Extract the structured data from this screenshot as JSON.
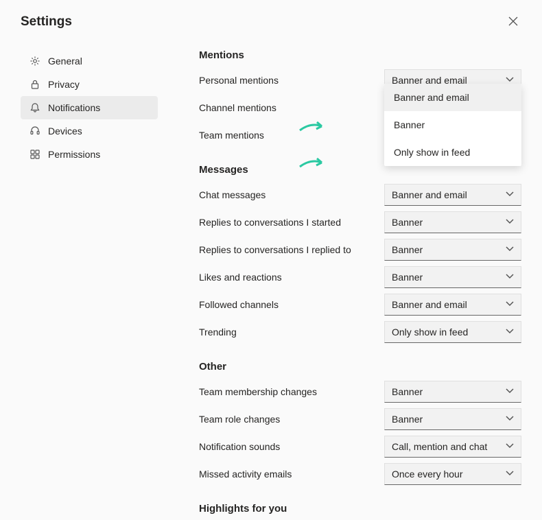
{
  "header": {
    "title": "Settings"
  },
  "sidebar": {
    "items": [
      {
        "label": "General"
      },
      {
        "label": "Privacy"
      },
      {
        "label": "Notifications"
      },
      {
        "label": "Devices"
      },
      {
        "label": "Permissions"
      }
    ]
  },
  "sections": {
    "mentions": {
      "title": "Mentions",
      "rows": {
        "personal": {
          "label": "Personal mentions",
          "value": "Banner and email"
        },
        "channel": {
          "label": "Channel mentions"
        },
        "team": {
          "label": "Team mentions"
        }
      },
      "dropdown": {
        "options": [
          "Banner and email",
          "Banner",
          "Only show in feed"
        ]
      }
    },
    "messages": {
      "title": "Messages",
      "rows": {
        "chat": {
          "label": "Chat messages",
          "value": "Banner and email"
        },
        "replies_started": {
          "label": "Replies to conversations I started",
          "value": "Banner"
        },
        "replies_replied": {
          "label": "Replies to conversations I replied to",
          "value": "Banner"
        },
        "likes": {
          "label": "Likes and reactions",
          "value": "Banner"
        },
        "followed": {
          "label": "Followed channels",
          "value": "Banner and email"
        },
        "trending": {
          "label": "Trending",
          "value": "Only show in feed"
        }
      }
    },
    "other": {
      "title": "Other",
      "rows": {
        "membership": {
          "label": "Team membership changes",
          "value": "Banner"
        },
        "role": {
          "label": "Team role changes",
          "value": "Banner"
        },
        "sounds": {
          "label": "Notification sounds",
          "value": "Call, mention and chat"
        },
        "missed": {
          "label": "Missed activity emails",
          "value": "Once every hour"
        }
      }
    },
    "highlights": {
      "title": "Highlights for you"
    }
  }
}
